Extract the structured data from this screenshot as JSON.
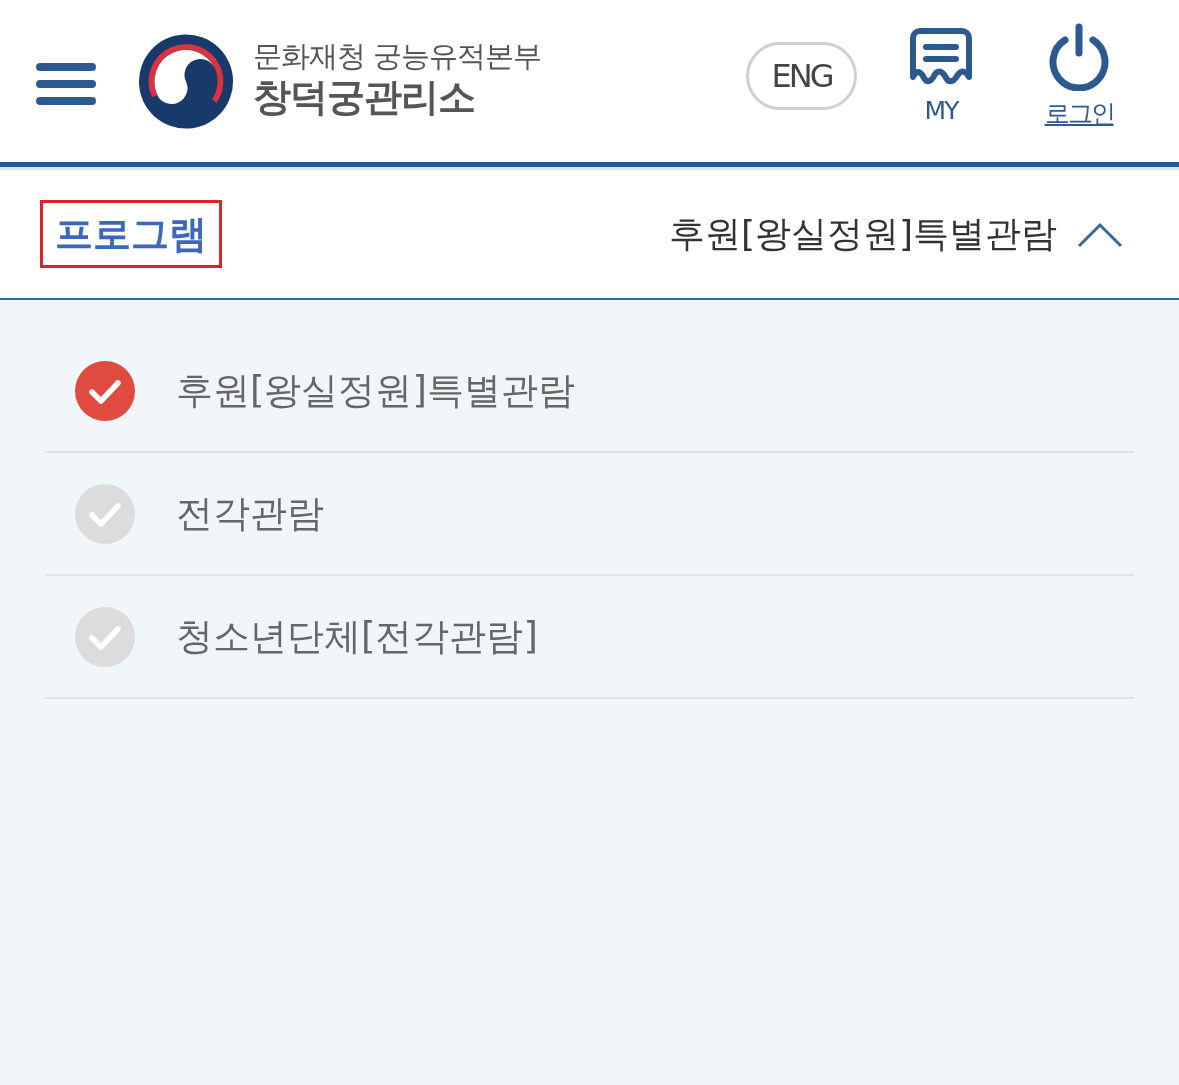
{
  "header": {
    "org_name": "문화재청 궁능유적본부",
    "site_name": "창덕궁관리소",
    "language_button": "ENG",
    "actions": [
      {
        "kind": "my",
        "label": "MY"
      },
      {
        "kind": "login",
        "label": "로그인"
      }
    ]
  },
  "program_bar": {
    "label": "프로그램",
    "highlighted": true,
    "current_value": "후원[왕실정원]특별관람",
    "expanded": true
  },
  "program_options": [
    {
      "label": "후원[왕실정원]특별관람",
      "selected": true
    },
    {
      "label": "전각관람",
      "selected": false
    },
    {
      "label": "청소년단체[전각관람]",
      "selected": false
    }
  ]
}
